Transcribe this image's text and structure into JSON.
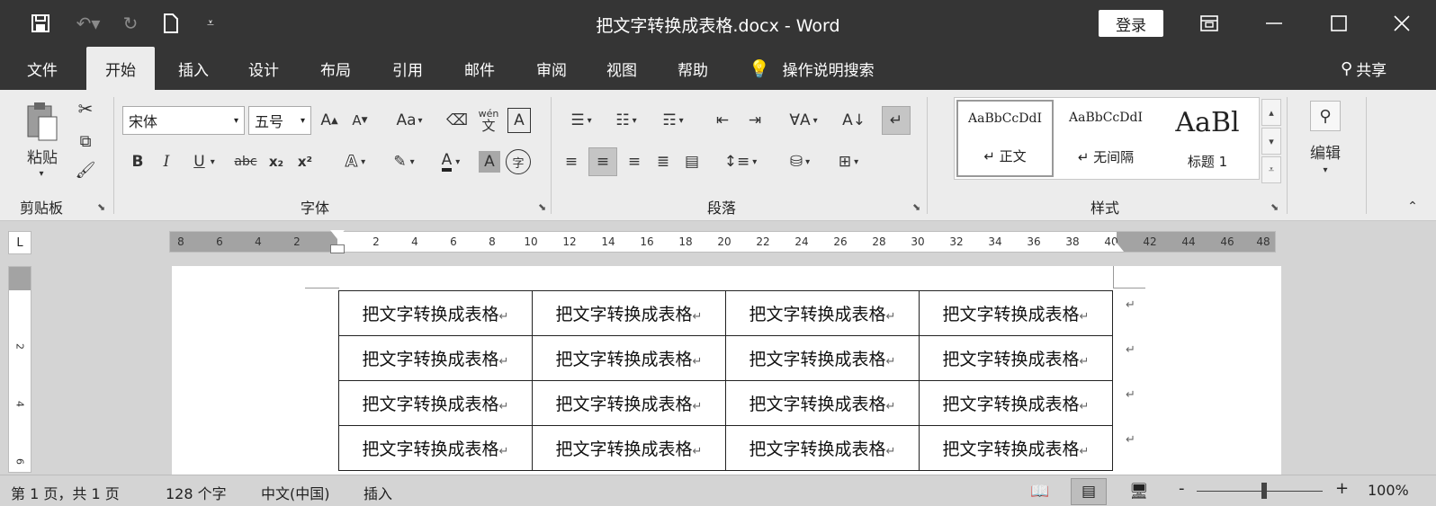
{
  "title_bar": {
    "doc_title": "把文字转换成表格.docx  -  Word",
    "login_label": "登录",
    "icons": [
      "save-icon",
      "undo-icon",
      "redo-icon",
      "new-doc-icon",
      "customize-qat-icon",
      "ribbon-display-icon",
      "minimize-icon",
      "maximize-icon",
      "close-icon"
    ]
  },
  "menu": {
    "tabs": [
      "文件",
      "开始",
      "插入",
      "设计",
      "布局",
      "引用",
      "邮件",
      "审阅",
      "视图",
      "帮助"
    ],
    "active_tab": "开始",
    "tell_me": "操作说明搜索",
    "share": "共享"
  },
  "ribbon": {
    "clipboard": {
      "paste": "粘贴",
      "label": "剪贴板"
    },
    "font": {
      "label": "字体",
      "font_name": "宋体",
      "font_size": "五号",
      "change_case": "Aa",
      "wen": "wén",
      "wen_char": "文",
      "bold": "B",
      "italic": "I",
      "underline": "U",
      "strikethrough": "abc",
      "subscript": "x₂",
      "superscript": "x²",
      "text_effect": "A",
      "font_color": "A",
      "char_shading": "A",
      "enclose_char": "字"
    },
    "paragraph": {
      "label": "段落"
    },
    "styles": {
      "label": "样式",
      "items": [
        {
          "preview": "AaBbCcDdI",
          "name": "↵ 正文"
        },
        {
          "preview": "AaBbCcDdI",
          "name": "↵ 无间隔"
        },
        {
          "preview": "AaBl",
          "name": "标题 1"
        }
      ]
    },
    "editing": {
      "label": "编辑"
    }
  },
  "ruler": {
    "left_ticks": [
      "8",
      "6",
      "4",
      "2"
    ],
    "ticks": [
      "2",
      "4",
      "6",
      "8",
      "10",
      "12",
      "14",
      "16",
      "18",
      "20",
      "22",
      "24",
      "26",
      "28",
      "30",
      "32",
      "34",
      "36",
      "38"
    ],
    "right_ticks": [
      "40",
      "42",
      "44",
      "46",
      "48"
    ],
    "tab_selector": "L"
  },
  "vertical_ruler": [
    "2",
    "4",
    "6"
  ],
  "document": {
    "table": [
      [
        "把文字转换成表格",
        "把文字转换成表格",
        "把文字转换成表格",
        "把文字转换成表格"
      ],
      [
        "把文字转换成表格",
        "把文字转换成表格",
        "把文字转换成表格",
        "把文字转换成表格"
      ],
      [
        "把文字转换成表格",
        "把文字转换成表格",
        "把文字转换成表格",
        "把文字转换成表格"
      ],
      [
        "把文字转换成表格",
        "把文字转换成表格",
        "把文字转换成表格",
        "把文字转换成表格"
      ]
    ],
    "para_mark": "↵"
  },
  "status_bar": {
    "page": "第 1 页，共 1 页",
    "words": "128 个字",
    "language": "中文(中国)",
    "mode": "插入",
    "zoom": "100%",
    "zoom_minus": "-",
    "zoom_plus": "+"
  }
}
